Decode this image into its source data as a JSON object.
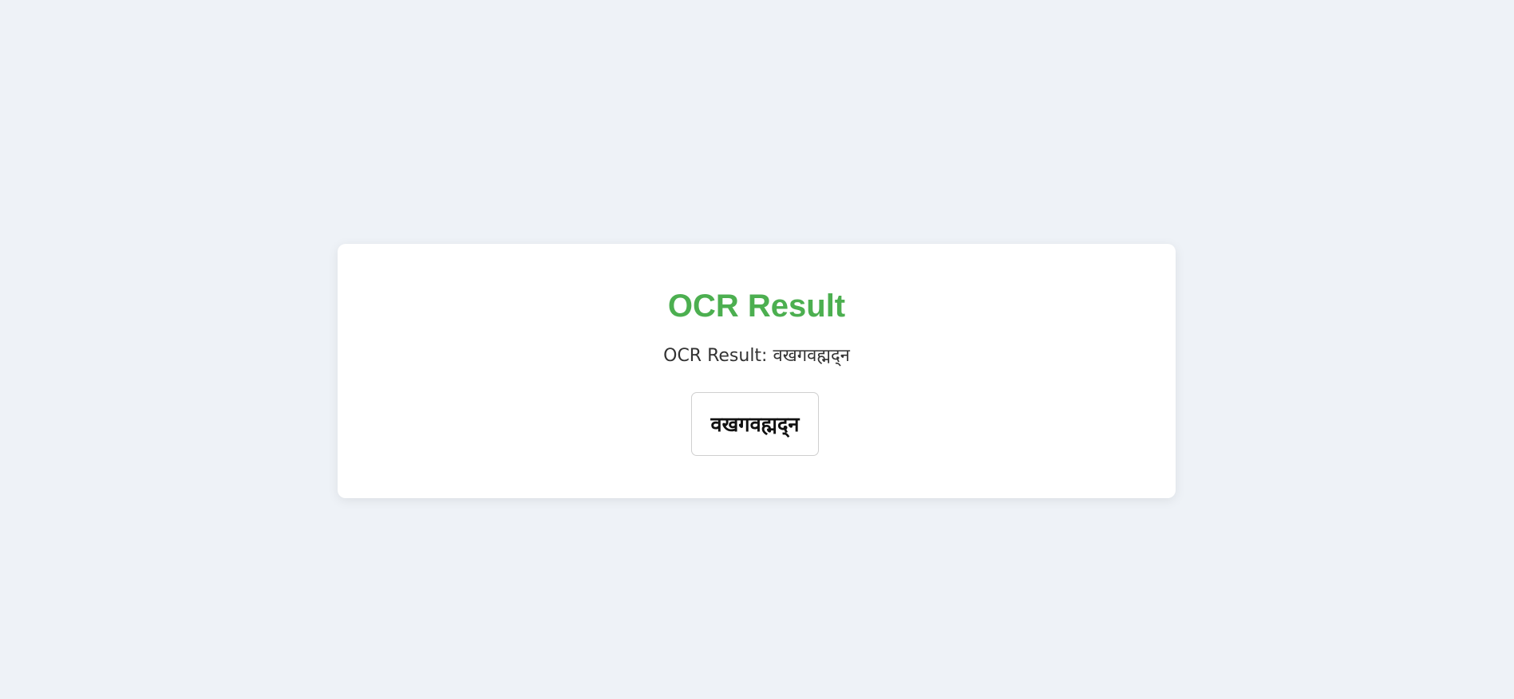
{
  "card": {
    "title": "OCR Result",
    "result_label": "OCR Result:",
    "result_text": "वखगवह्मद्न"
  },
  "captcha": {
    "image_text": "वखगवह्मद्न",
    "text_color": "#111111"
  },
  "colors": {
    "page_background": "#eef2f7",
    "card_background": "#ffffff",
    "title_color": "#4caf50",
    "body_text": "#333333"
  }
}
